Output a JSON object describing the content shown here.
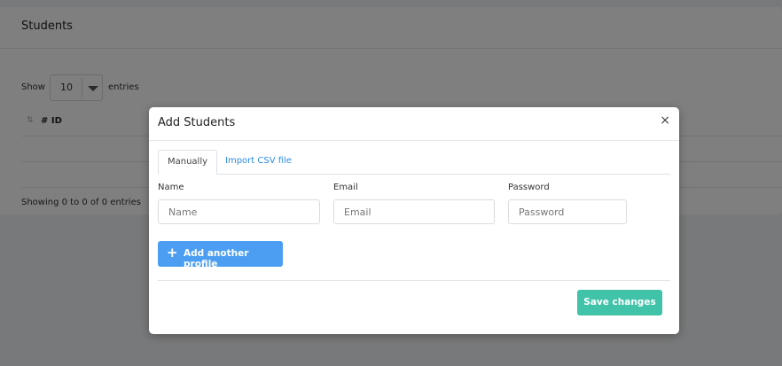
{
  "page": {
    "card_title": "Students",
    "show_label": "Show",
    "entries_value": "10",
    "entries_label": "entries",
    "table": {
      "columns": [
        "# ID"
      ]
    },
    "showing_text": "Showing 0 to 0 of 0 entries"
  },
  "modal": {
    "title": "Add Students",
    "close_label": "×",
    "tabs": [
      {
        "label": "Manually",
        "active": true
      },
      {
        "label": "Import CSV file",
        "active": false
      }
    ],
    "fields": {
      "name": {
        "label": "Name",
        "placeholder": "Name",
        "value": ""
      },
      "email": {
        "label": "Email",
        "placeholder": "Email",
        "value": ""
      },
      "password": {
        "label": "Password",
        "placeholder": "Password",
        "value": ""
      }
    },
    "add_profile": {
      "icon": "plus-icon",
      "label": "Add another profile"
    },
    "save_label": "Save changes"
  },
  "colors": {
    "primary_blue": "#4b9ef2",
    "link_blue": "#2d8be5",
    "save_teal": "#41c3a9"
  }
}
